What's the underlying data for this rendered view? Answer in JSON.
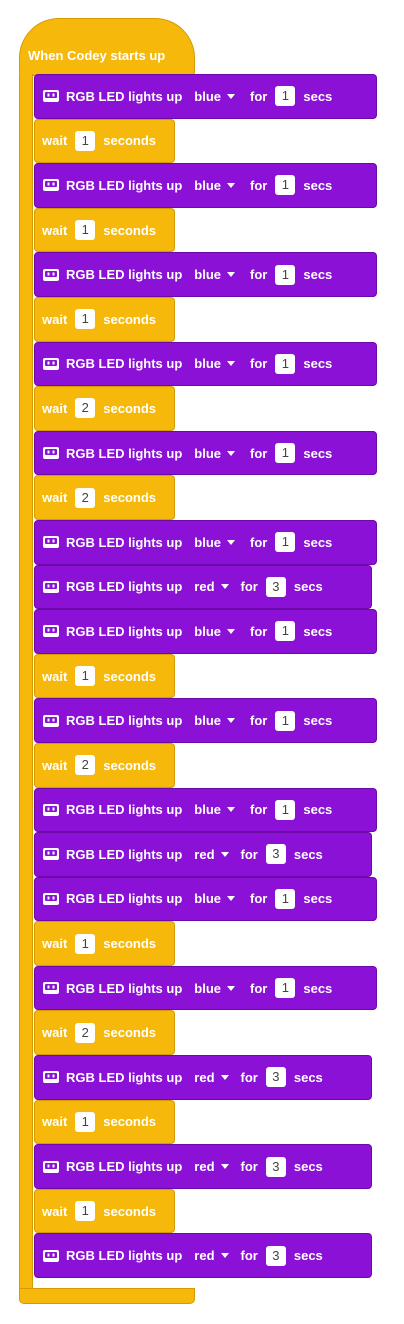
{
  "hat_label": "When Codey starts up",
  "blocks": [
    {
      "type": "led",
      "label": "RGB LED lights up",
      "color": "blue",
      "for": "for",
      "value": "1",
      "unit": "secs"
    },
    {
      "type": "wait",
      "label": "wait",
      "value": "1",
      "unit": "seconds"
    },
    {
      "type": "led",
      "label": "RGB LED lights up",
      "color": "blue",
      "for": "for",
      "value": "1",
      "unit": "secs"
    },
    {
      "type": "wait",
      "label": "wait",
      "value": "1",
      "unit": "seconds"
    },
    {
      "type": "led",
      "label": "RGB LED lights up",
      "color": "blue",
      "for": "for",
      "value": "1",
      "unit": "secs"
    },
    {
      "type": "wait",
      "label": "wait",
      "value": "1",
      "unit": "seconds"
    },
    {
      "type": "led",
      "label": "RGB LED lights up",
      "color": "blue",
      "for": "for",
      "value": "1",
      "unit": "secs"
    },
    {
      "type": "wait",
      "label": "wait",
      "value": "2",
      "unit": "seconds"
    },
    {
      "type": "led",
      "label": "RGB LED lights up",
      "color": "blue",
      "for": "for",
      "value": "1",
      "unit": "secs"
    },
    {
      "type": "wait",
      "label": "wait",
      "value": "2",
      "unit": "seconds"
    },
    {
      "type": "led",
      "label": "RGB LED lights up",
      "color": "blue",
      "for": "for",
      "value": "1",
      "unit": "secs"
    },
    {
      "type": "led",
      "label": "RGB LED lights up",
      "color": "red",
      "for": "for",
      "value": "3",
      "unit": "secs"
    },
    {
      "type": "led",
      "label": "RGB LED lights up",
      "color": "blue",
      "for": "for",
      "value": "1",
      "unit": "secs"
    },
    {
      "type": "wait",
      "label": "wait",
      "value": "1",
      "unit": "seconds"
    },
    {
      "type": "led",
      "label": "RGB LED lights up",
      "color": "blue",
      "for": "for",
      "value": "1",
      "unit": "secs"
    },
    {
      "type": "wait",
      "label": "wait",
      "value": "2",
      "unit": "seconds"
    },
    {
      "type": "led",
      "label": "RGB LED lights up",
      "color": "blue",
      "for": "for",
      "value": "1",
      "unit": "secs"
    },
    {
      "type": "led",
      "label": "RGB LED lights up",
      "color": "red",
      "for": "for",
      "value": "3",
      "unit": "secs"
    },
    {
      "type": "led",
      "label": "RGB LED lights up",
      "color": "blue",
      "for": "for",
      "value": "1",
      "unit": "secs"
    },
    {
      "type": "wait",
      "label": "wait",
      "value": "1",
      "unit": "seconds"
    },
    {
      "type": "led",
      "label": "RGB LED lights up",
      "color": "blue",
      "for": "for",
      "value": "1",
      "unit": "secs"
    },
    {
      "type": "wait",
      "label": "wait",
      "value": "2",
      "unit": "seconds"
    },
    {
      "type": "led",
      "label": "RGB LED lights up",
      "color": "red",
      "for": "for",
      "value": "3",
      "unit": "secs"
    },
    {
      "type": "wait",
      "label": "wait",
      "value": "1",
      "unit": "seconds"
    },
    {
      "type": "led",
      "label": "RGB LED lights up",
      "color": "red",
      "for": "for",
      "value": "3",
      "unit": "secs"
    },
    {
      "type": "wait",
      "label": "wait",
      "value": "1",
      "unit": "seconds"
    },
    {
      "type": "led",
      "label": "RGB LED lights up",
      "color": "red",
      "for": "for",
      "value": "3",
      "unit": "secs"
    }
  ],
  "colors": {
    "led_block": "#8b11d6",
    "wait_block": "#f6b90b",
    "hat_block": "#f6b90b"
  },
  "icons": {
    "led_block": "codey-robot-icon",
    "dropdown": "caret-down-icon"
  }
}
